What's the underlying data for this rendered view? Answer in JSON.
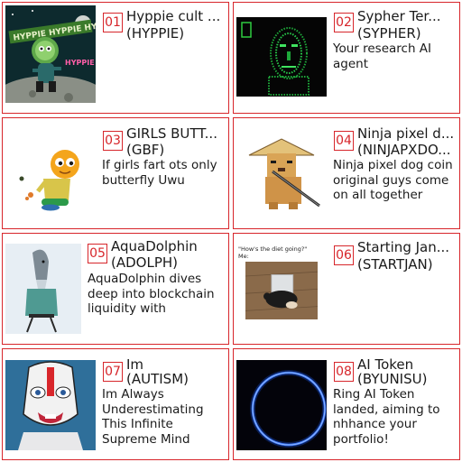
{
  "tokens": [
    {
      "rank": "01",
      "name": "Hyppie cult ...",
      "ticker": "(HYPPIE)",
      "description": ""
    },
    {
      "rank": "02",
      "name": "Sypher Ter...",
      "ticker": "(SYPHER)",
      "description": "Your research AI agent"
    },
    {
      "rank": "03",
      "name": "GIRLS BUTT...",
      "ticker": "(GBF)",
      "description": "If girls fart ots only butterfly Uwu"
    },
    {
      "rank": "04",
      "name": "Ninja pixel d...",
      "ticker": "(NINJAPXDO...",
      "description": "Ninja pixel dog coin original guys come on all together"
    },
    {
      "rank": "05",
      "name": "AquaDolphin",
      "ticker": "(ADOLPH)",
      "description": "AquaDolphin dives deep into blockchain liquidity with unmatc..."
    },
    {
      "rank": "06",
      "name": "Starting Jan...",
      "ticker": "(STARTJAN)",
      "description": ""
    },
    {
      "rank": "07",
      "name": "Im",
      "ticker": "(AUTISM)",
      "description": "Im Always Underestimating This Infinite Supreme Mind"
    },
    {
      "rank": "08",
      "name": "AI Token",
      "ticker": "(BYUNISU)",
      "description": "Ring AI Token landed, aiming to nhhance your portfolio!"
    }
  ],
  "thumbs": {
    "hyppie_banner_text": "HYPPIE HYPPIE HYPPIE",
    "hyppie_side_text": "HYPPIE HYPE",
    "startjan_caption_line1": "\"How's the diet going?\"",
    "startjan_caption_line2": "Me:"
  },
  "colors": {
    "accent": "#d7262b"
  }
}
